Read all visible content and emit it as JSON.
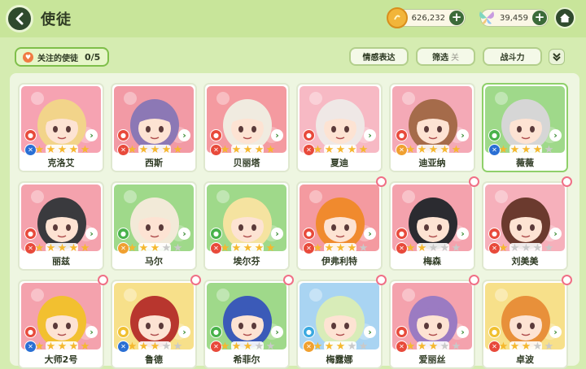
{
  "header": {
    "title": "使徒"
  },
  "currency": [
    {
      "name": "gold",
      "value": "626,232",
      "icon": "coin-icon"
    },
    {
      "name": "crystal",
      "value": "39,459",
      "icon": "butterfly-crystal-icon"
    }
  ],
  "toolbar": {
    "favorite_label": "关注的使徒",
    "favorite_count": "0/5",
    "emotion_label": "情感表达",
    "filter_label": "筛选",
    "filter_state": "关",
    "power_label": "战斗力"
  },
  "colors": {
    "accent": "#7fbf4a",
    "dark": "#2f4a2d",
    "star": "#f5b82e"
  },
  "characters": [
    {
      "name": "克洛艾",
      "bg": "#f6a3b2",
      "stars": 5,
      "b1": "#e84a3b",
      "b2": "#2a6fd4",
      "hair": "#f2d48a",
      "sel": false,
      "flower": false
    },
    {
      "name": "西斯",
      "bg": "#f29aa5",
      "stars": 5,
      "b1": "#e84a3b",
      "b2": "#e84a3b",
      "hair": "#8c78b5",
      "sel": false,
      "flower": false
    },
    {
      "name": "贝丽塔",
      "bg": "#f49aa0",
      "stars": 5,
      "b1": "#e84a3b",
      "b2": "#e84a3b",
      "hair": "#f0ebe0",
      "sel": false,
      "flower": false
    },
    {
      "name": "夏迪",
      "bg": "#f7b9c4",
      "stars": 5,
      "b1": "#e84a3b",
      "b2": "#e84a3b",
      "hair": "#efe8e6",
      "sel": false,
      "flower": false
    },
    {
      "name": "迪亚纳",
      "bg": "#f4a9b6",
      "stars": 5,
      "b1": "#e84a3b",
      "b2": "#f0a030",
      "hair": "#a56b4a",
      "sel": false,
      "flower": false
    },
    {
      "name": "薇薇",
      "bg": "#9fd98a",
      "stars": 4,
      "b1": "#48b24a",
      "b2": "#2a6fd4",
      "hair": "#d6d6d6",
      "sel": true,
      "flower": false
    },
    {
      "name": "丽兹",
      "bg": "#f4a2ad",
      "stars": 5,
      "b1": "#e84a3b",
      "b2": "#e84a3b",
      "hair": "#3a3a3e",
      "sel": false,
      "flower": false
    },
    {
      "name": "马尔",
      "bg": "#9fd98a",
      "stars": 3,
      "b1": "#48b24a",
      "b2": "#f0a030",
      "hair": "#f2ead8",
      "sel": false,
      "flower": false
    },
    {
      "name": "埃尔芬",
      "bg": "#9fd98a",
      "stars": 5,
      "b1": "#48b24a",
      "b2": "#e84a3b",
      "hair": "#f5e3a0",
      "sel": false,
      "flower": false
    },
    {
      "name": "伊弗利特",
      "bg": "#f49aa0",
      "stars": 4,
      "b1": "#e84a3b",
      "b2": "#e84a3b",
      "hair": "#f08a2e",
      "sel": false,
      "flower": true
    },
    {
      "name": "梅森",
      "bg": "#f4a2ad",
      "stars": 2,
      "b1": "#e84a3b",
      "b2": "#e84a3b",
      "hair": "#2b2b30",
      "sel": false,
      "flower": true
    },
    {
      "name": "刘美美",
      "bg": "#f6b0bb",
      "stars": 1,
      "b1": "#e84a3b",
      "b2": "#e84a3b",
      "hair": "#6b3a2e",
      "sel": false,
      "flower": true
    },
    {
      "name": "大师2号",
      "bg": "#f4a2ad",
      "stars": 5,
      "b1": "#e84a3b",
      "b2": "#2a6fd4",
      "hair": "#f2c030",
      "sel": false,
      "flower": true
    },
    {
      "name": "鲁德",
      "bg": "#f7e08a",
      "stars": 3,
      "b1": "#f0c030",
      "b2": "#2a6fd4",
      "hair": "#b8362e",
      "sel": false,
      "flower": true
    },
    {
      "name": "希菲尔",
      "bg": "#9fd98a",
      "stars": 3,
      "b1": "#48b24a",
      "b2": "#e84a3b",
      "hair": "#3b5ab8",
      "sel": false,
      "flower": true
    },
    {
      "name": "梅露娜",
      "bg": "#a9d4f2",
      "stars": 3,
      "b1": "#3aa9e0",
      "b2": "#f0a030",
      "hair": "#d8ecb8",
      "sel": false,
      "flower": true
    },
    {
      "name": "爱丽丝",
      "bg": "#f4a2ad",
      "stars": 3,
      "b1": "#e84a3b",
      "b2": "#e84a3b",
      "hair": "#9b7bc2",
      "sel": false,
      "flower": true
    },
    {
      "name": "卓波",
      "bg": "#f7e08a",
      "stars": 3,
      "b1": "#f0c030",
      "b2": "#e84a3b",
      "hair": "#e8903a",
      "sel": false,
      "flower": true
    }
  ]
}
